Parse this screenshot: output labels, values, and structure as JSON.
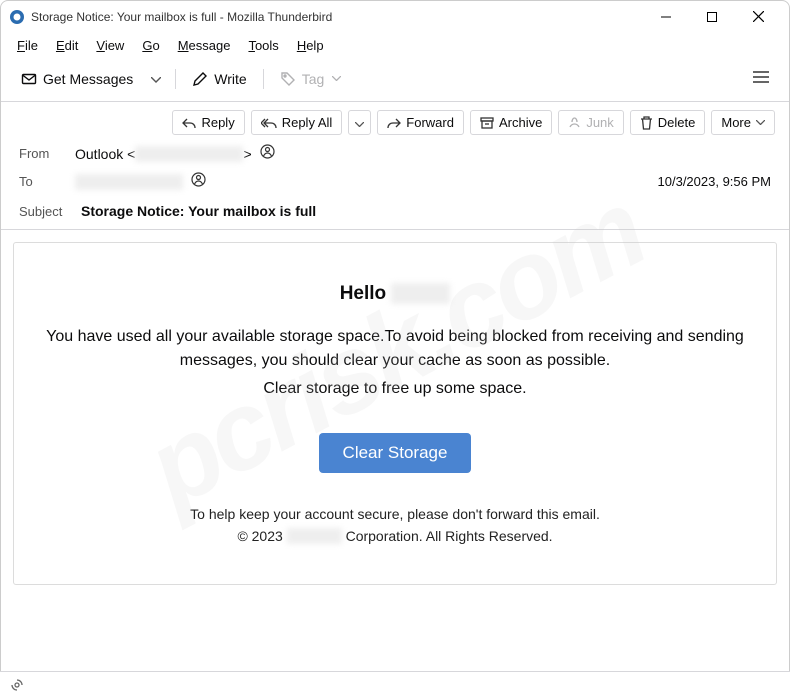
{
  "window": {
    "title": "Storage Notice: Your mailbox is full - Mozilla Thunderbird"
  },
  "menubar": {
    "file": "File",
    "edit": "Edit",
    "view": "View",
    "go": "Go",
    "message": "Message",
    "tools": "Tools",
    "help": "Help"
  },
  "toolbar": {
    "get_messages": "Get Messages",
    "write": "Write",
    "tag": "Tag"
  },
  "actions": {
    "reply": "Reply",
    "reply_all": "Reply All",
    "forward": "Forward",
    "archive": "Archive",
    "junk": "Junk",
    "delete": "Delete",
    "more": "More"
  },
  "header": {
    "from_label": "From",
    "from_value": "Outlook <",
    "from_redacted": "xxxxxx@xxx.xxx",
    "from_close": ">",
    "to_label": "To",
    "to_redacted": "xxxxxx@xxx.xxx",
    "date": "10/3/2023, 9:56 PM",
    "subject_label": "Subject",
    "subject_value": "Storage Notice: Your mailbox is full"
  },
  "body": {
    "hello_prefix": "Hello ",
    "hello_redacted": "xxxxx",
    "line1": "You have used all your available storage space.To avoid being blocked from receiving and sending messages, you should clear your cache as soon as possible.",
    "line2": "Clear storage to free up some space.",
    "button": "Clear Storage",
    "footer1": "To help keep your account secure, please don't forward this email.",
    "footer2_prefix": "© 2023 ",
    "footer2_redacted": "xxxxxxx",
    "footer2_suffix": " Corporation. All Rights Reserved."
  },
  "watermark": "pcrisk.com"
}
